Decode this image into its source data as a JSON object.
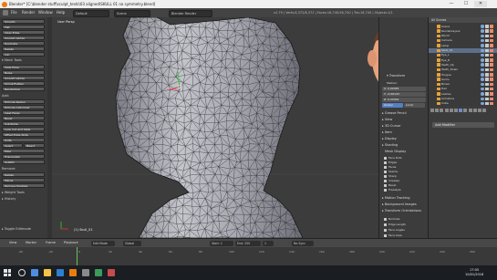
{
  "window": {
    "title": "Blender* [C:\\blender stuff\\sculpt_tests\\03 aligned\\SKULL 01 no symmetry.blend]",
    "controls": [
      "—",
      "☐",
      "✕"
    ]
  },
  "menubar": {
    "items": [
      "File",
      "Render",
      "Window",
      "Help"
    ],
    "layout_field": "Default",
    "scene_field": "Scene",
    "engine_field": "Blender Render",
    "stats": "v2.79 | Verts:8,372/8,372 | Faces:16,740/16,740 | Tris:16,740 | Objects:1/1"
  },
  "left_panel": {
    "top_buttons": [
      "Smooth",
      "Flat",
      "Clear Edge",
      "Smooth Vertex",
      "Duplicate",
      "Delete",
      "Join"
    ],
    "section_mesh_tools": "▾ Mesh Tools",
    "deform_buttons": [
      "Slide Edge",
      "Noise",
      "Smooth Vertex",
      "Shrink/Flatten",
      "Randomize"
    ],
    "section_add": "Add:",
    "add_buttons": [
      "Extrude Region",
      "Extrude Individual",
      "Inset Faces",
      "Bevel",
      "Subdivide",
      "Loop Cut and Slide",
      "Offset Edge Slide",
      "Knife",
      "Select",
      "Bisect",
      "Poke",
      "Triangulate",
      "Solidify"
    ],
    "section_remove": "Remove:",
    "remove_buttons": [
      "Delete",
      "Merge",
      "Remove Doubles"
    ],
    "section_weight": "▸ Weight Tools",
    "section_history": "▸ History",
    "toggle_editmode": "▸ Toggle Editmode"
  },
  "viewport": {
    "label": "User Persp",
    "object_label": "(1) Skull_01",
    "mesh_color": "#cfcfd6",
    "wire_color": "#222222",
    "background": "#3c3c3c"
  },
  "right_panel": {
    "transform_header": "▾ Transform",
    "fields": [
      "Median:",
      "X: 0.00345",
      "Y: -0.06143",
      "Z: 0.33322",
      "Global",
      "Local"
    ],
    "sections": [
      "▸ Grease Pencil",
      "▸ View",
      "▸ 3D Cursor",
      "▸ Item",
      "▸ Display",
      "▸ Shading",
      "▸ Motion Tracking",
      "▸ Background Images",
      "▸ Transform Orientations"
    ],
    "mesh_display": "Mesh Display",
    "overlay_items": [
      "Face Dots",
      "Edges",
      "Faces",
      "Seams",
      "Sharp",
      "Creases",
      "Bevel",
      "Freestyle"
    ],
    "checkboxes": [
      "Normals",
      "Edge Length",
      "Face Angles",
      "Face Area"
    ]
  },
  "outliner": {
    "header": "All Scenes",
    "rows": [
      "Scene",
      "RenderLayers",
      "World",
      "Camera",
      "Lamp",
      "Skull_01",
      "Eye_L",
      "Eye_R",
      "Teeth_Up",
      "Teeth_Down",
      "Tongue",
      "Gums",
      "Brows",
      "Hair",
      "Lashes",
      "Armature",
      "Cube"
    ]
  },
  "properties": {
    "add_modifier": "Add Modifier"
  },
  "timeline": {
    "items": [
      "View",
      "Marker",
      "Frame",
      "Playback"
    ],
    "start_field": "Start: 1",
    "end_field": "End: 250",
    "current_field": "1",
    "sync": "No Sync",
    "mode": "Edit Mode",
    "pivot": "Global"
  },
  "frame_ticks": [
    "-40",
    "-20",
    "0",
    "20",
    "40",
    "60",
    "80",
    "100",
    "120",
    "140",
    "160",
    "180",
    "200",
    "220",
    "240",
    "260"
  ],
  "taskbar": {
    "time": "17:05",
    "date": "10/01/2018"
  }
}
